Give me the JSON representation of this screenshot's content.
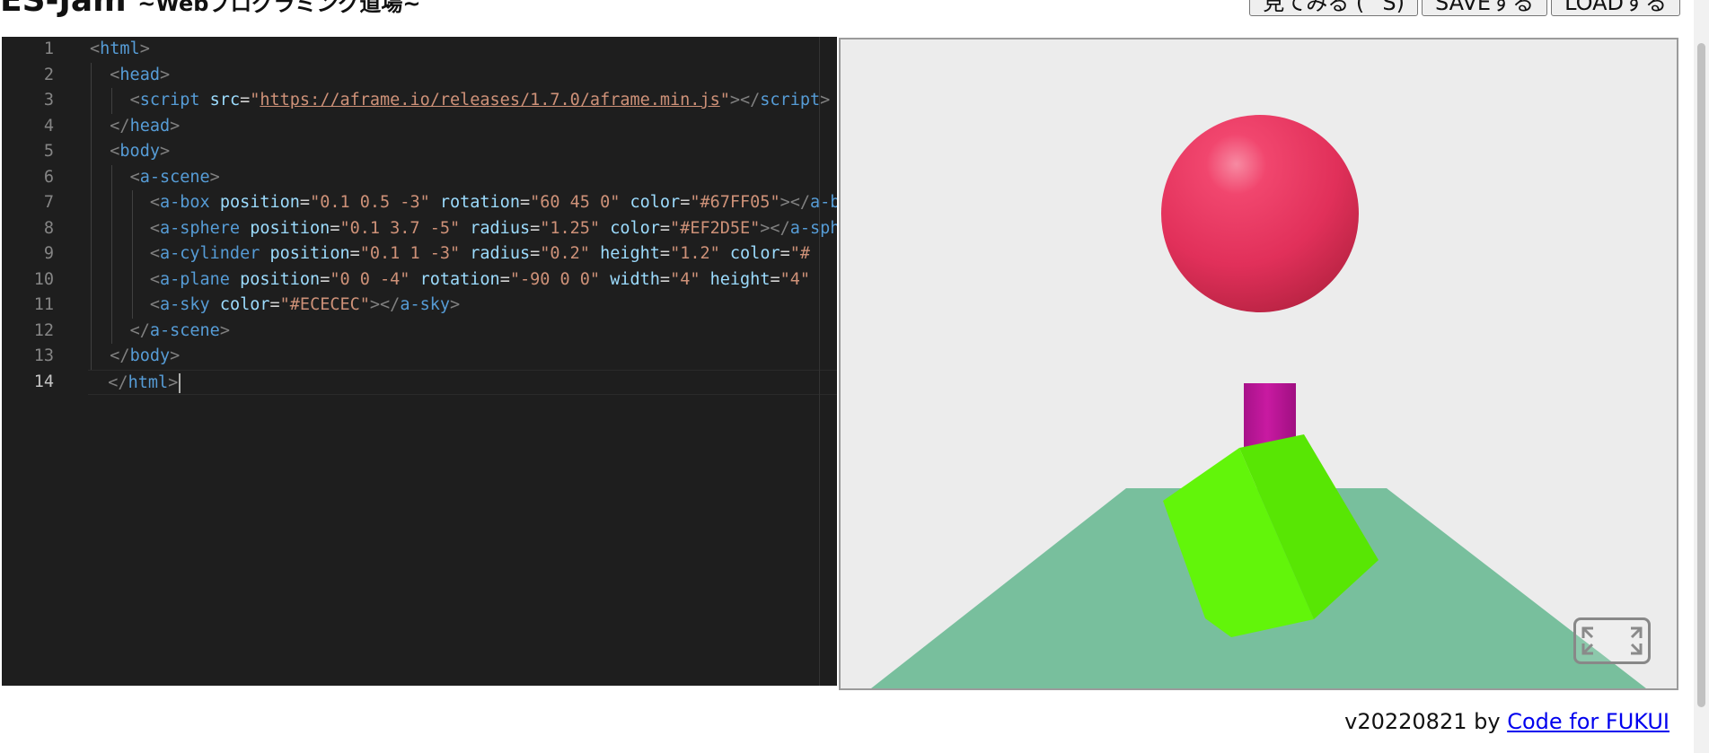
{
  "header": {
    "title": "ES-Jam",
    "subtitle": "~Webプログラミング道場~",
    "buttons": [
      {
        "label": "見てみる (^S)"
      },
      {
        "label": "SAVEする"
      },
      {
        "label": "LOADする"
      }
    ]
  },
  "editor": {
    "line_numbers": [
      "1",
      "2",
      "3",
      "4",
      "5",
      "6",
      "7",
      "8",
      "9",
      "10",
      "11",
      "12",
      "13",
      "14"
    ],
    "active_line": "14"
  },
  "preview": {
    "sky_color": "#ECECEC",
    "sphere_color": "#EF2D5E",
    "box_color": "#67FF05",
    "plane_color": "#7BC8A4",
    "cylinder_color": "#C0169A"
  },
  "footer": {
    "version": "v20220821 by ",
    "link_text": "Code for FUKUI"
  }
}
